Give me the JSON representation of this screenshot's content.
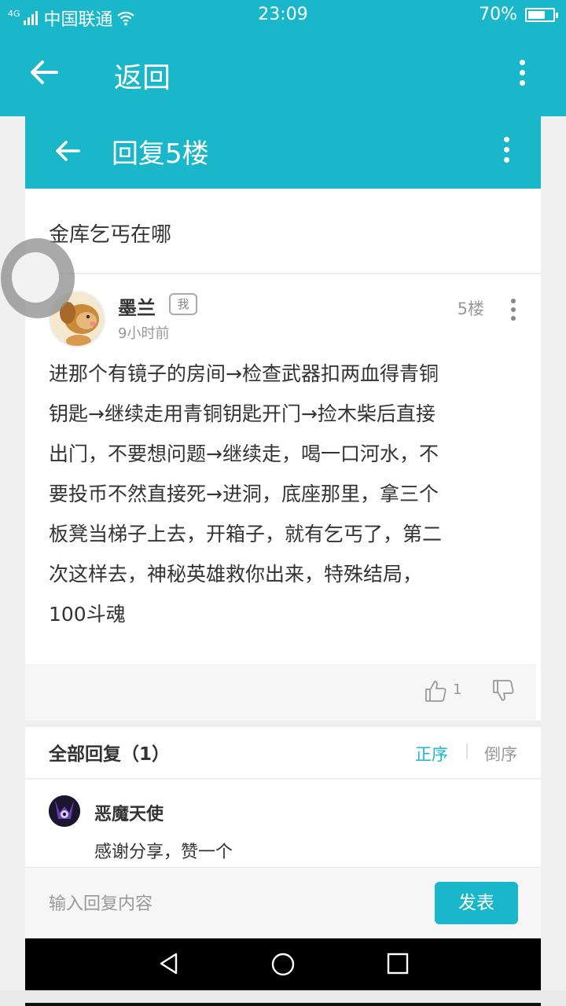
{
  "status_bar": {
    "network": "4G",
    "carrier": "中国联通",
    "time": "23:09",
    "battery_text": "70%",
    "battery_level": 0.7
  },
  "outer_header": {
    "title": "返回"
  },
  "dialog": {
    "title": "回复5楼",
    "post_title": "金库乞丐在哪",
    "author": {
      "name": "墨兰",
      "badge": "我",
      "time": "9小时前",
      "floor": "5楼"
    },
    "body_lines": [
      "进那个有镜子的房间→检查武器扣两血得青铜",
      "钥匙→继续走用青铜钥匙开门→捡木柴后直接",
      "出门，不要想问题→继续走，喝一口河水，不",
      "要投币不然直接死→进洞，底座那里，拿三个",
      "板凳当梯子上去，开箱子，就有乞丐了，第二",
      "次这样去，神秘英雄救你出来，特殊结局，",
      "100斗魂"
    ],
    "likes": "1",
    "replies_header": "全部回复（1）",
    "sort_asc": "正序",
    "sort_desc": "倒序",
    "reply": {
      "user": "恶魔天使",
      "text": "感谢分享，赞一个"
    },
    "input_placeholder": "输入回复内容",
    "send_label": "发表"
  },
  "colors": {
    "accent": "#19b7c9",
    "muted": "#999999"
  }
}
